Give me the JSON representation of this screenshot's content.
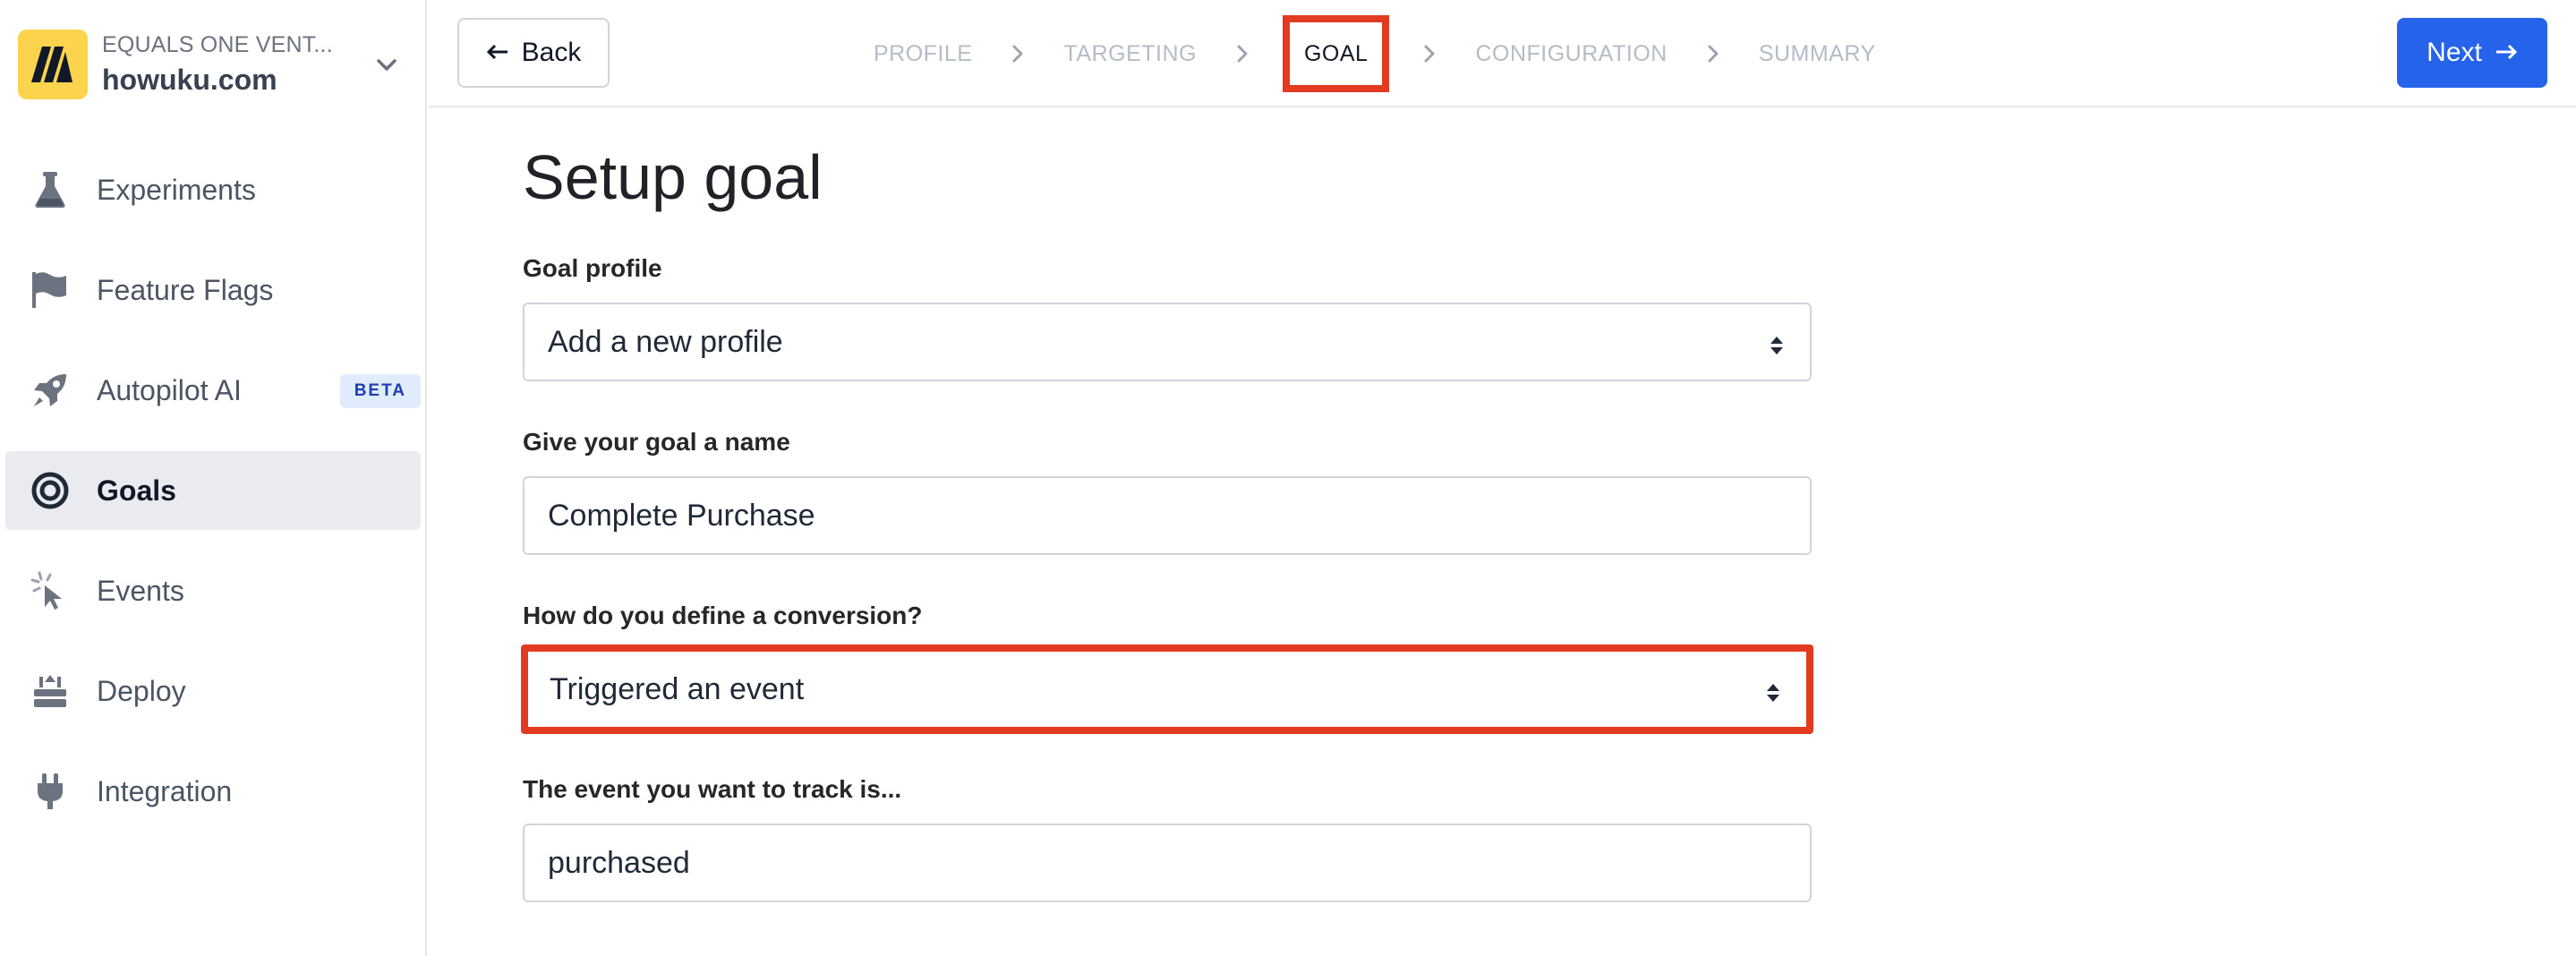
{
  "workspace": {
    "org": "EQUALS ONE VENT...",
    "domain": "howuku.com",
    "logo_color": "#fcd34d"
  },
  "sidebar": {
    "items": [
      {
        "label": "Experiments",
        "icon": "flask-icon"
      },
      {
        "label": "Feature Flags",
        "icon": "flag-icon"
      },
      {
        "label": "Autopilot AI",
        "icon": "rocket-icon",
        "badge": "BETA"
      },
      {
        "label": "Goals",
        "icon": "target-icon",
        "active": true
      },
      {
        "label": "Events",
        "icon": "cursor-click-icon"
      },
      {
        "label": "Deploy",
        "icon": "deploy-icon"
      },
      {
        "label": "Integration",
        "icon": "plug-icon"
      }
    ]
  },
  "topbar": {
    "back_label": "Back",
    "next_label": "Next",
    "steps": [
      "PROFILE",
      "TARGETING",
      "GOAL",
      "CONFIGURATION",
      "SUMMARY"
    ],
    "current_step": "GOAL",
    "accent_color": "#2563eb",
    "highlight_color": "#e23b22"
  },
  "form": {
    "title": "Setup goal",
    "goal_profile": {
      "label": "Goal profile",
      "value": "Add a new profile"
    },
    "goal_name": {
      "label": "Give your goal a name",
      "value": "Complete Purchase"
    },
    "conversion": {
      "label": "How do you define a conversion?",
      "value": "Triggered an event"
    },
    "event": {
      "label": "The event you want to track is...",
      "value": "purchased"
    }
  }
}
